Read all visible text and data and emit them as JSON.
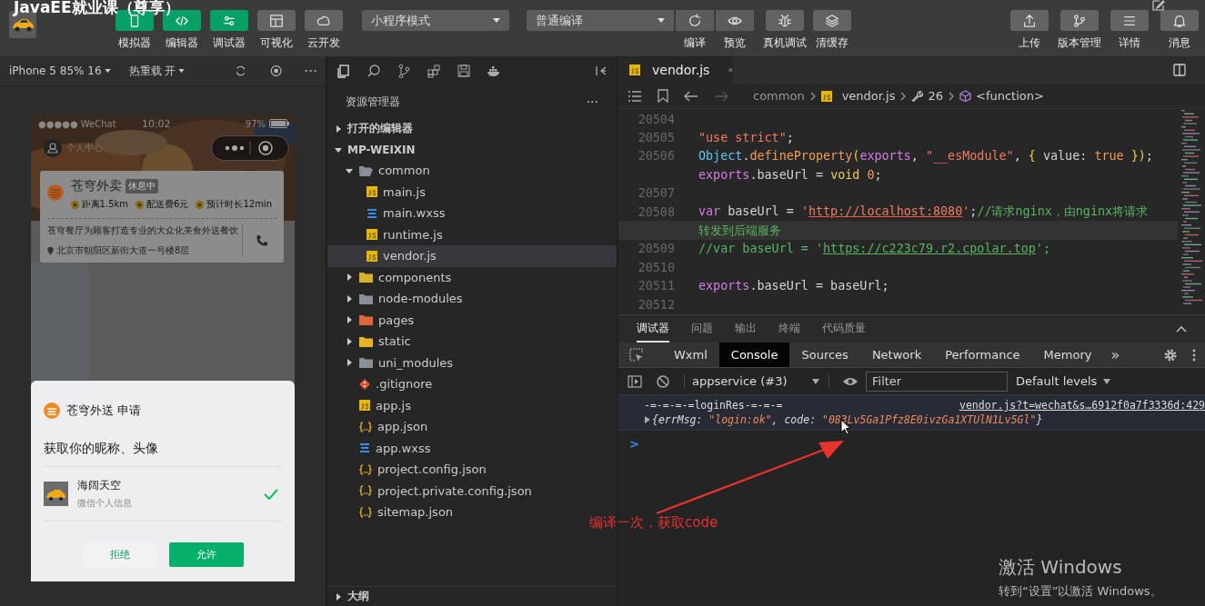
{
  "overlay_title": "JavaEE就业课（尊享）",
  "toolbar": {
    "left_buttons": [
      {
        "label": "模拟器",
        "kind": "phone",
        "on": true
      },
      {
        "label": "编辑器",
        "kind": "code",
        "on": true
      },
      {
        "label": "调试器",
        "kind": "sliders",
        "on": true
      },
      {
        "label": "可视化",
        "kind": "layout",
        "on": false
      },
      {
        "label": "云开发",
        "kind": "cloud",
        "on": false
      }
    ],
    "mode_select": "小程序模式",
    "compile_select": "普通编译",
    "compile_buttons": [
      {
        "label": "编译",
        "kind": "refresh"
      },
      {
        "label": "预览",
        "kind": "eye"
      }
    ],
    "tool_buttons": [
      {
        "label": "真机调试",
        "kind": "bug"
      },
      {
        "label": "清缓存",
        "kind": "layers"
      }
    ],
    "right_buttons": [
      {
        "label": "上传",
        "kind": "upload"
      },
      {
        "label": "版本管理",
        "kind": "branch"
      },
      {
        "label": "详情",
        "kind": "menu"
      },
      {
        "label": "消息",
        "kind": "bell"
      }
    ]
  },
  "simulator": {
    "device": "iPhone 5 85% 16",
    "hot_reload": "热重载 开",
    "phone": {
      "carrier": "●●●●● WeChat",
      "time": "10:02",
      "battery": "97%",
      "nav_label": "个人中心",
      "shop": {
        "name": "苍穹外卖",
        "status": "休息中",
        "stats": [
          "距离1.5km",
          "配送费6元",
          "预计时长12min"
        ],
        "description": "苍穹餐厅为顾客打造专业的大众化美食外送餐饮",
        "address": "北京市朝阳区新街大道一号楼8层"
      },
      "dialog": {
        "title": "苍穹外送 申请",
        "request": "获取你的昵称、头像",
        "user_name": "海阔天空",
        "user_note": "微信个人信息",
        "checked": true,
        "reject": "拒绝",
        "allow": "允许"
      }
    }
  },
  "explorer": {
    "title": "资源管理器",
    "more": "···",
    "sections": [
      {
        "label": "打开的编辑器",
        "expanded": false
      },
      {
        "label": "MP-WEIXIN",
        "expanded": true
      }
    ],
    "tree": [
      {
        "name": "common",
        "kind": "folder",
        "expanded": true,
        "selected": false,
        "children": [
          {
            "name": "main.js",
            "kind": "js",
            "selected": false
          },
          {
            "name": "main.wxss",
            "kind": "wxss",
            "selected": false
          },
          {
            "name": "runtime.js",
            "kind": "js",
            "selected": false
          },
          {
            "name": "vendor.js",
            "kind": "js",
            "selected": true
          }
        ]
      },
      {
        "name": "components",
        "kind": "folder-components",
        "expanded": false,
        "selected": false
      },
      {
        "name": "node-modules",
        "kind": "folder",
        "expanded": false,
        "selected": false
      },
      {
        "name": "pages",
        "kind": "folder-pages",
        "expanded": false,
        "selected": false
      },
      {
        "name": "static",
        "kind": "folder-static",
        "expanded": false,
        "selected": false
      },
      {
        "name": "uni_modules",
        "kind": "folder",
        "expanded": false,
        "selected": false
      },
      {
        "name": ".gitignore",
        "kind": "git",
        "selected": false
      },
      {
        "name": "app.js",
        "kind": "js",
        "selected": false
      },
      {
        "name": "app.json",
        "kind": "json",
        "selected": false
      },
      {
        "name": "app.wxss",
        "kind": "wxss",
        "selected": false
      },
      {
        "name": "project.config.json",
        "kind": "json",
        "selected": false
      },
      {
        "name": "project.private.config.json",
        "kind": "json",
        "selected": false
      },
      {
        "name": "sitemap.json",
        "kind": "json",
        "selected": false
      }
    ],
    "outline": {
      "label": "大纲",
      "expanded": false
    }
  },
  "editor": {
    "tab": {
      "name": "vendor.js",
      "selected": true
    },
    "breadcrumb": [
      "common",
      "vendor.js",
      "26",
      "<function>"
    ],
    "lines": [
      {
        "number": "20504",
        "current": false
      },
      {
        "number": "20505",
        "current": false,
        "parts": [
          {
            "t": "\"use strict\"",
            "kind": "str"
          },
          {
            "t": ";",
            "kind": "plain"
          }
        ]
      },
      {
        "number": "20506",
        "current": false,
        "parts": [
          {
            "t": "Object",
            "kind": "obj"
          },
          {
            "t": ".",
            "kind": "plain"
          },
          {
            "t": "defineProperty",
            "kind": "fn"
          },
          {
            "t": "(",
            "kind": "brace"
          },
          {
            "t": "exports",
            "kind": "kw"
          },
          {
            "t": ", ",
            "kind": "plain"
          },
          {
            "t": "\"__esModule\"",
            "kind": "str"
          },
          {
            "t": ", ",
            "kind": "plain"
          },
          {
            "t": "{",
            "kind": "brace"
          },
          {
            "t": " value: ",
            "kind": "plain"
          },
          {
            "t": "true",
            "kind": "lit"
          },
          {
            "t": " }",
            "kind": "brace"
          },
          {
            "t": ")",
            "kind": "brace"
          },
          {
            "t": ";",
            "kind": "plain"
          }
        ]
      },
      {
        "current": false,
        "parts": [
          {
            "t": "exports",
            "kind": "kw"
          },
          {
            "t": ".baseUrl = ",
            "kind": "plain"
          },
          {
            "t": "void",
            "kind": "void"
          },
          {
            "t": " 0",
            "kind": "lit"
          },
          {
            "t": ";",
            "kind": "plain"
          }
        ]
      },
      {
        "number": "20507",
        "current": false
      },
      {
        "number": "20508",
        "current": false,
        "parts": [
          {
            "t": "var",
            "kind": "kw"
          },
          {
            "t": " baseUrl = ",
            "kind": "plain"
          },
          {
            "t": "'",
            "kind": "str"
          },
          {
            "t": "http://localhost:8080",
            "kind": "url"
          },
          {
            "t": "'",
            "kind": "str"
          },
          {
            "t": ";",
            "kind": "plain"
          },
          {
            "t": "//请求nginx，由nginx将请求",
            "kind": "com"
          }
        ]
      },
      {
        "current": true,
        "parts": [
          {
            "t": "转发到后端服务",
            "kind": "com"
          }
        ]
      },
      {
        "number": "20509",
        "current": false,
        "parts": [
          {
            "t": "//var baseUrl = '",
            "kind": "com"
          },
          {
            "t": "https://c223c79.r2.cpolar.top",
            "kind": "comurl"
          },
          {
            "t": "';",
            "kind": "com"
          }
        ]
      },
      {
        "number": "20510",
        "current": false
      },
      {
        "number": "20511",
        "current": false,
        "parts": [
          {
            "t": "exports",
            "kind": "kw"
          },
          {
            "t": ".baseUrl = baseUrl;",
            "kind": "plain"
          }
        ]
      },
      {
        "number": "20512",
        "current": false
      }
    ]
  },
  "panel": {
    "tabs": [
      {
        "label": "调试器",
        "selected": true
      },
      {
        "label": "问题",
        "selected": false
      },
      {
        "label": "输出",
        "selected": false
      },
      {
        "label": "终端",
        "selected": false
      },
      {
        "label": "代码质量",
        "selected": false
      }
    ],
    "devtools_tabs": [
      {
        "label": "Wxml",
        "selected": false
      },
      {
        "label": "Console",
        "selected": true
      },
      {
        "label": "Sources",
        "selected": false
      },
      {
        "label": "Network",
        "selected": false
      },
      {
        "label": "Performance",
        "selected": false
      },
      {
        "label": "Memory",
        "selected": false
      }
    ],
    "overflow": "»",
    "context": "appservice (#3)",
    "filter_placeholder": "Filter",
    "levels": "Default levels",
    "log": {
      "text": "-=-=-=-=loginRes-=-=-=",
      "source": "vendor.js?t=wechat&s…6912f0a7f3336d:429"
    },
    "object": [
      {
        "t": "{",
        "kind": "punc"
      },
      {
        "t": "errMsg: ",
        "kind": "key"
      },
      {
        "t": "\"login:ok\"",
        "kind": "val"
      },
      {
        "t": ", ",
        "kind": "punc"
      },
      {
        "t": "code: ",
        "kind": "key"
      },
      {
        "t": "\"083Lv5Ga1Pfz8E0ivzGa1XTUlN1Lv5Gl\"",
        "kind": "val"
      },
      {
        "t": "}",
        "kind": "punc"
      }
    ],
    "prompt": ">"
  },
  "annotation": {
    "text": "编译一次，获取code"
  },
  "os_notice": {
    "title": "激活 Windows",
    "subtitle": "转到“设置”以激活 Windows。"
  }
}
